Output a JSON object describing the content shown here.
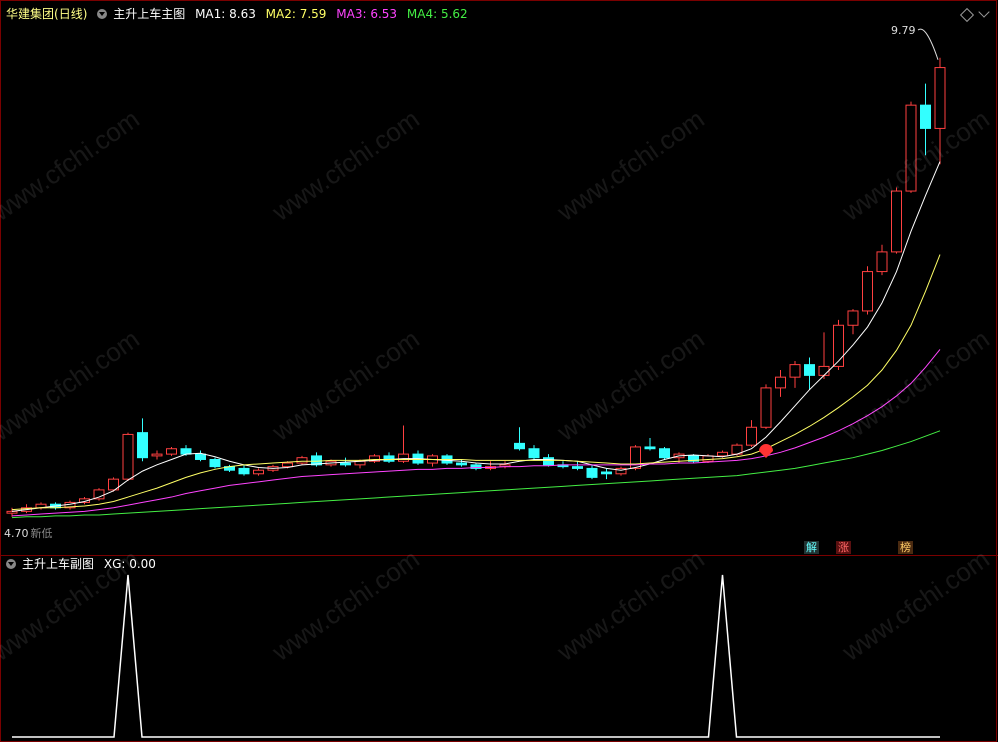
{
  "main_panel": {
    "stock_name": "华建集团",
    "period": "(日线)",
    "indicator_name": "主升上车主图",
    "ma_labels": [
      {
        "label": "MA1: 8.63",
        "color": "#ffffff"
      },
      {
        "label": "MA2: 7.59",
        "color": "#ffff66"
      },
      {
        "label": "MA3: 6.53",
        "color": "#ff44ff"
      },
      {
        "label": "MA4: 5.62",
        "color": "#44ee44"
      }
    ],
    "high_label": "9.79",
    "low_label": "4.70",
    "low_suffix": "新低",
    "badges": [
      {
        "text": "解",
        "color": "#66ffff",
        "bg": "#333333"
      },
      {
        "text": "涨",
        "color": "#ff6666",
        "bg": "#5a1010"
      },
      {
        "text": "榜",
        "color": "#ffcc66",
        "bg": "#4a2a10"
      }
    ]
  },
  "sub_panel": {
    "indicator_name": "主升上车副图",
    "xg_label": "XG: 0.00"
  },
  "watermark": "www.cfchi.com",
  "chart_data": [
    {
      "type": "candlestick",
      "title": "主升上车主图",
      "ylim": [
        4.4,
        10.1
      ],
      "colors": {
        "up": "#ff4040",
        "down": "#33ffff"
      },
      "candles": [
        [
          4.7,
          4.76,
          4.66,
          4.72
        ],
        [
          4.72,
          4.8,
          4.7,
          4.76
        ],
        [
          4.76,
          4.82,
          4.74,
          4.8
        ],
        [
          4.8,
          4.82,
          4.74,
          4.76
        ],
        [
          4.76,
          4.84,
          4.74,
          4.82
        ],
        [
          4.82,
          4.88,
          4.8,
          4.86
        ],
        [
          4.86,
          4.98,
          4.84,
          4.96
        ],
        [
          4.96,
          5.1,
          4.94,
          5.08
        ],
        [
          5.08,
          5.6,
          5.06,
          5.58
        ],
        [
          5.6,
          5.76,
          5.28,
          5.32
        ],
        [
          5.34,
          5.4,
          5.3,
          5.36
        ],
        [
          5.36,
          5.44,
          5.34,
          5.42
        ],
        [
          5.42,
          5.46,
          5.34,
          5.36
        ],
        [
          5.36,
          5.4,
          5.28,
          5.3
        ],
        [
          5.3,
          5.32,
          5.2,
          5.22
        ],
        [
          5.22,
          5.24,
          5.16,
          5.18
        ],
        [
          5.2,
          5.24,
          5.12,
          5.14
        ],
        [
          5.14,
          5.2,
          5.12,
          5.18
        ],
        [
          5.18,
          5.24,
          5.16,
          5.22
        ],
        [
          5.22,
          5.28,
          5.2,
          5.26
        ],
        [
          5.26,
          5.34,
          5.24,
          5.32
        ],
        [
          5.34,
          5.38,
          5.22,
          5.24
        ],
        [
          5.24,
          5.3,
          5.22,
          5.28
        ],
        [
          5.26,
          5.32,
          5.22,
          5.24
        ],
        [
          5.24,
          5.3,
          5.2,
          5.28
        ],
        [
          5.28,
          5.36,
          5.26,
          5.34
        ],
        [
          5.34,
          5.38,
          5.26,
          5.28
        ],
        [
          5.28,
          5.68,
          5.26,
          5.36
        ],
        [
          5.36,
          5.4,
          5.24,
          5.26
        ],
        [
          5.26,
          5.36,
          5.22,
          5.34
        ],
        [
          5.34,
          5.36,
          5.24,
          5.26
        ],
        [
          5.26,
          5.3,
          5.22,
          5.24
        ],
        [
          5.24,
          5.26,
          5.18,
          5.2
        ],
        [
          5.2,
          5.28,
          5.18,
          5.22
        ],
        [
          5.22,
          5.28,
          5.2,
          5.24
        ],
        [
          5.48,
          5.66,
          5.4,
          5.42
        ],
        [
          5.42,
          5.46,
          5.3,
          5.32
        ],
        [
          5.32,
          5.36,
          5.22,
          5.24
        ],
        [
          5.24,
          5.28,
          5.2,
          5.22
        ],
        [
          5.22,
          5.28,
          5.18,
          5.2
        ],
        [
          5.2,
          5.24,
          5.08,
          5.1
        ],
        [
          5.16,
          5.2,
          5.08,
          5.14
        ],
        [
          5.14,
          5.22,
          5.12,
          5.2
        ],
        [
          5.2,
          5.46,
          5.18,
          5.44
        ],
        [
          5.44,
          5.54,
          5.4,
          5.42
        ],
        [
          5.42,
          5.44,
          5.3,
          5.32
        ],
        [
          5.32,
          5.38,
          5.26,
          5.36
        ],
        [
          5.34,
          5.36,
          5.26,
          5.28
        ],
        [
          5.28,
          5.36,
          5.26,
          5.34
        ],
        [
          5.34,
          5.4,
          5.32,
          5.38
        ],
        [
          5.36,
          5.48,
          5.34,
          5.46
        ],
        [
          5.46,
          5.74,
          5.44,
          5.66
        ],
        [
          5.66,
          6.14,
          5.64,
          6.1
        ],
        [
          6.1,
          6.3,
          6.0,
          6.22
        ],
        [
          6.22,
          6.4,
          6.1,
          6.36
        ],
        [
          6.36,
          6.44,
          6.08,
          6.24
        ],
        [
          6.24,
          6.72,
          6.2,
          6.34
        ],
        [
          6.34,
          6.86,
          6.3,
          6.8
        ],
        [
          6.8,
          6.98,
          6.7,
          6.96
        ],
        [
          6.96,
          7.46,
          6.92,
          7.4
        ],
        [
          7.4,
          7.7,
          7.36,
          7.62
        ],
        [
          7.62,
          8.34,
          7.6,
          8.3
        ],
        [
          8.3,
          9.3,
          8.28,
          9.26
        ],
        [
          9.26,
          9.5,
          8.7,
          9.0
        ],
        [
          9.0,
          9.79,
          8.6,
          9.68
        ]
      ],
      "ma_series": [
        {
          "name": "MA1",
          "color": "#ffffff",
          "values": [
            4.72,
            4.74,
            4.76,
            4.78,
            4.8,
            4.83,
            4.88,
            4.95,
            5.07,
            5.17,
            5.24,
            5.3,
            5.36,
            5.37,
            5.33,
            5.28,
            5.24,
            5.21,
            5.2,
            5.21,
            5.24,
            5.25,
            5.26,
            5.27,
            5.28,
            5.29,
            5.3,
            5.31,
            5.31,
            5.3,
            5.29,
            5.28,
            5.26,
            5.25,
            5.25,
            5.28,
            5.3,
            5.3,
            5.29,
            5.28,
            5.24,
            5.2,
            5.18,
            5.21,
            5.25,
            5.3,
            5.34,
            5.35,
            5.34,
            5.33,
            5.36,
            5.42,
            5.55,
            5.72,
            5.9,
            6.08,
            6.24,
            6.4,
            6.58,
            6.78,
            7.05,
            7.4,
            7.85,
            8.25,
            8.63
          ]
        },
        {
          "name": "MA2",
          "color": "#ffff66",
          "values": [
            4.74,
            4.75,
            4.76,
            4.76,
            4.77,
            4.78,
            4.8,
            4.83,
            4.88,
            4.93,
            4.98,
            5.04,
            5.1,
            5.15,
            5.19,
            5.22,
            5.24,
            5.25,
            5.26,
            5.27,
            5.28,
            5.28,
            5.29,
            5.29,
            5.29,
            5.3,
            5.3,
            5.3,
            5.3,
            5.3,
            5.3,
            5.3,
            5.29,
            5.29,
            5.29,
            5.29,
            5.29,
            5.29,
            5.29,
            5.28,
            5.27,
            5.26,
            5.25,
            5.25,
            5.26,
            5.27,
            5.28,
            5.29,
            5.3,
            5.31,
            5.33,
            5.36,
            5.42,
            5.5,
            5.58,
            5.67,
            5.77,
            5.88,
            6.0,
            6.13,
            6.3,
            6.52,
            6.8,
            7.18,
            7.59
          ]
        },
        {
          "name": "MA3",
          "color": "#ff44ff",
          "values": [
            4.67,
            4.68,
            4.69,
            4.7,
            4.71,
            4.72,
            4.74,
            4.76,
            4.79,
            4.82,
            4.85,
            4.88,
            4.92,
            4.95,
            4.98,
            5.01,
            5.03,
            5.05,
            5.07,
            5.09,
            5.11,
            5.12,
            5.13,
            5.14,
            5.15,
            5.16,
            5.17,
            5.18,
            5.19,
            5.19,
            5.2,
            5.2,
            5.21,
            5.21,
            5.22,
            5.22,
            5.23,
            5.23,
            5.24,
            5.24,
            5.24,
            5.24,
            5.24,
            5.24,
            5.25,
            5.25,
            5.26,
            5.26,
            5.27,
            5.28,
            5.29,
            5.31,
            5.34,
            5.38,
            5.43,
            5.49,
            5.55,
            5.62,
            5.7,
            5.79,
            5.89,
            6.01,
            6.15,
            6.33,
            6.53
          ]
        },
        {
          "name": "MA4",
          "color": "#44ee44",
          "values": [
            4.65,
            4.66,
            4.66,
            4.67,
            4.67,
            4.68,
            4.68,
            4.69,
            4.7,
            4.71,
            4.72,
            4.73,
            4.74,
            4.75,
            4.76,
            4.77,
            4.78,
            4.79,
            4.8,
            4.81,
            4.82,
            4.83,
            4.84,
            4.85,
            4.86,
            4.87,
            4.88,
            4.89,
            4.9,
            4.91,
            4.92,
            4.93,
            4.94,
            4.95,
            4.96,
            4.97,
            4.98,
            4.99,
            5.0,
            5.01,
            5.02,
            5.03,
            5.04,
            5.05,
            5.06,
            5.07,
            5.08,
            5.09,
            5.1,
            5.11,
            5.12,
            5.14,
            5.16,
            5.18,
            5.2,
            5.23,
            5.26,
            5.29,
            5.32,
            5.36,
            5.4,
            5.45,
            5.5,
            5.56,
            5.62
          ]
        }
      ],
      "signal_marker_index": 52
    },
    {
      "type": "line",
      "title": "主升上车副图",
      "ylim": [
        0,
        1
      ],
      "series": [
        {
          "name": "XG",
          "color": "#ffffff",
          "values": [
            0,
            0,
            0,
            0,
            0,
            0,
            0,
            0,
            1,
            0,
            0,
            0,
            0,
            0,
            0,
            0,
            0,
            0,
            0,
            0,
            0,
            0,
            0,
            0,
            0,
            0,
            0,
            0,
            0,
            0,
            0,
            0,
            0,
            0,
            0,
            0,
            0,
            0,
            0,
            0,
            0,
            0,
            0,
            0,
            0,
            0,
            0,
            0,
            0,
            1,
            0,
            0,
            0,
            0,
            0,
            0,
            0,
            0,
            0,
            0,
            0,
            0,
            0,
            0,
            0
          ]
        }
      ]
    }
  ]
}
